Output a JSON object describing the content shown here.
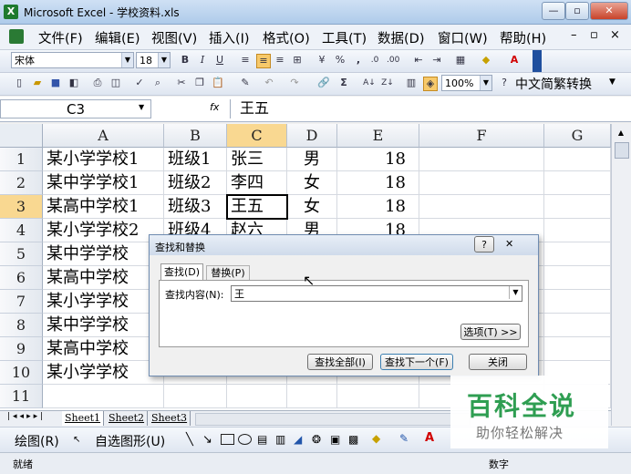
{
  "window": {
    "title": "Microsoft Excel - 学校资料.xls",
    "app_icon": "X",
    "min": "—",
    "restore": "▫",
    "close": "✕"
  },
  "menu": {
    "items": [
      "文件(F)",
      "编辑(E)",
      "视图(V)",
      "插入(I)",
      "格式(O)",
      "工具(T)",
      "数据(D)",
      "窗口(W)",
      "帮助(H)"
    ],
    "doc_min": "–",
    "doc_restore": "▫",
    "doc_close": "×"
  },
  "format_toolbar": {
    "font": "宋体",
    "size": "18",
    "bold": "B",
    "italic": "I",
    "underline": "U",
    "percent": "%",
    "comma": ","
  },
  "std_toolbar": {
    "zoom": "100%",
    "chinese_convert": "中文简繁转换"
  },
  "formula_bar": {
    "namebox": "C3",
    "fx": "fx",
    "content": "王五"
  },
  "columns": [
    "A",
    "B",
    "C",
    "D",
    "E",
    "F",
    "G"
  ],
  "rows": [
    {
      "num": "1",
      "A": "某小学学校1",
      "B": "班级1",
      "C": "张三",
      "D": "男",
      "E": "18"
    },
    {
      "num": "2",
      "A": "某中学学校1",
      "B": "班级2",
      "C": "李四",
      "D": "女",
      "E": "18"
    },
    {
      "num": "3",
      "A": "某高中学校1",
      "B": "班级3",
      "C": "王五",
      "D": "女",
      "E": "18"
    },
    {
      "num": "4",
      "A": "某小学学校2",
      "B": "班级4",
      "C": "赵六",
      "D": "男",
      "E": "18"
    },
    {
      "num": "5",
      "A": "某中学学校",
      "B": "",
      "C": "",
      "D": "",
      "E": ""
    },
    {
      "num": "6",
      "A": "某高中学校",
      "B": "",
      "C": "",
      "D": "",
      "E": ""
    },
    {
      "num": "7",
      "A": "某小学学校",
      "B": "",
      "C": "",
      "D": "",
      "E": ""
    },
    {
      "num": "8",
      "A": "某中学学校",
      "B": "",
      "C": "",
      "D": "",
      "E": ""
    },
    {
      "num": "9",
      "A": "某高中学校",
      "B": "",
      "C": "",
      "D": "",
      "E": ""
    },
    {
      "num": "10",
      "A": "某小学学校",
      "B": "",
      "C": "",
      "D": "",
      "E": ""
    },
    {
      "num": "11",
      "A": "",
      "B": "",
      "C": "",
      "D": "",
      "E": ""
    }
  ],
  "sheet_tabs": [
    "Sheet1",
    "Sheet2",
    "Sheet3"
  ],
  "draw_toolbar": {
    "draw": "绘图(R)",
    "autoshape": "自选图形(U)"
  },
  "status": {
    "left": "就绪",
    "right": "数字"
  },
  "dialog": {
    "title": "查找和替换",
    "help": "?",
    "close": "✕",
    "tab_find": "查找(D)",
    "tab_replace": "替换(P)",
    "label": "查找内容(N):",
    "value": "王",
    "options": "选项(T) >>",
    "find_all": "查找全部(I)",
    "find_next": "查找下一个(F)",
    "close_btn": "关闭"
  },
  "watermark": {
    "title": "百科全说",
    "subtitle": "助你轻松解决"
  },
  "colors": {
    "watermark_green": "#2f9e52",
    "selected_cell_border": "#000000",
    "title_bar": "#aecbea"
  }
}
